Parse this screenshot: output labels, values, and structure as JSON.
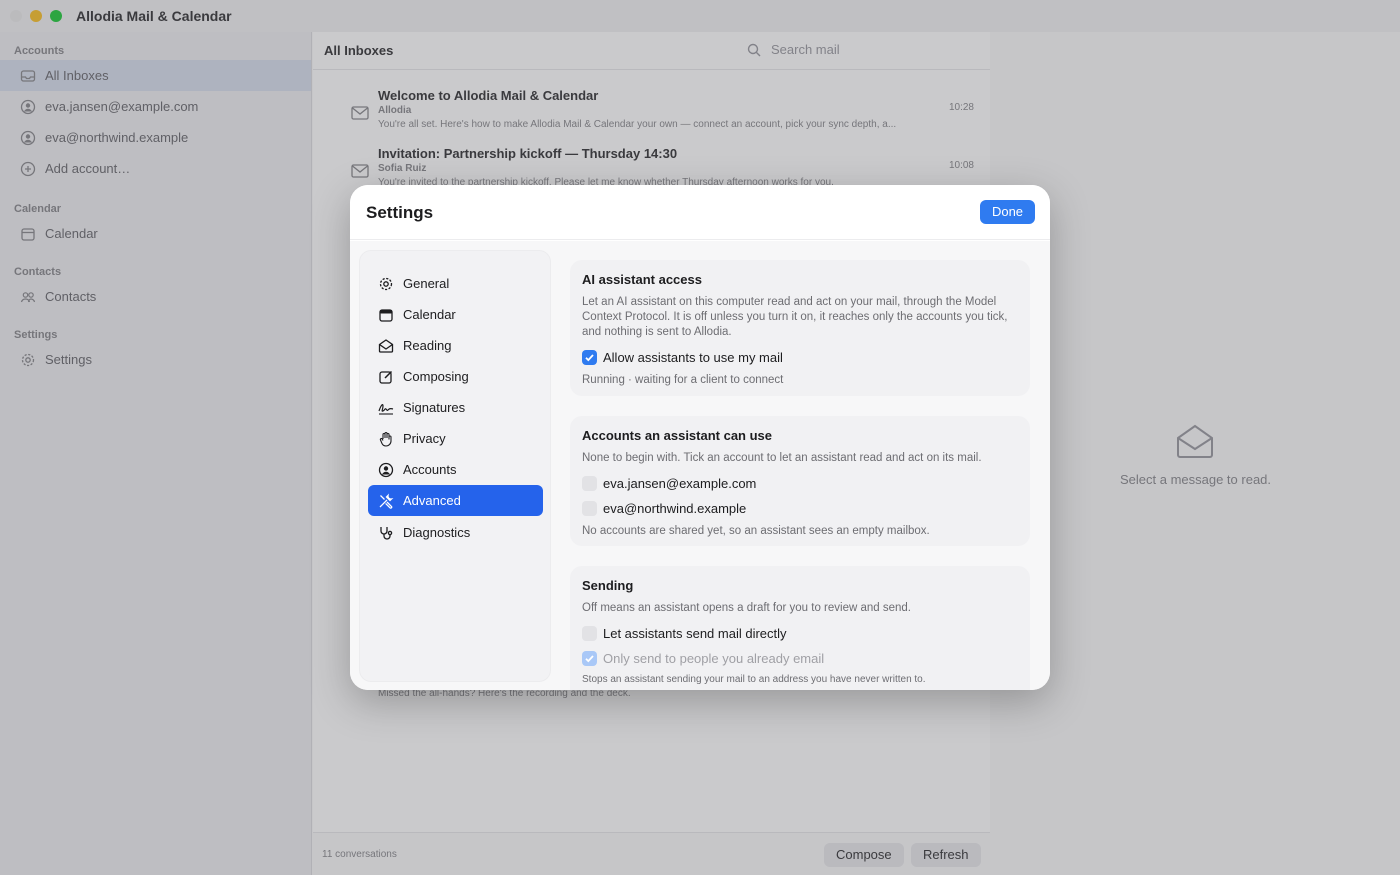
{
  "window": {
    "title": "Allodia Mail & Calendar"
  },
  "sidebar": {
    "sections": {
      "accounts": "Accounts",
      "calendar": "Calendar",
      "contacts": "Contacts",
      "settings": "Settings"
    },
    "items": [
      {
        "label": "All Inboxes",
        "icon": "inbox-icon",
        "active": true
      },
      {
        "label": "eva.jansen@example.com",
        "icon": "account-icon"
      },
      {
        "label": "eva@northwind.example",
        "icon": "account-icon"
      },
      {
        "label": "Add account…",
        "icon": "plus-circle-icon"
      },
      {
        "label": "Calendar",
        "icon": "calendar-icon"
      },
      {
        "label": "Contacts",
        "icon": "people-icon"
      },
      {
        "label": "Settings",
        "icon": "gear-icon"
      }
    ]
  },
  "list": {
    "title": "All Inboxes",
    "search_placeholder": "Search mail",
    "messages": [
      {
        "subject": "Welcome to Allodia Mail & Calendar",
        "from": "Allodia",
        "preview": "You're all set. Here's how to make Allodia Mail & Calendar your own — connect an account, pick your sync depth, a...",
        "time": "10:28"
      },
      {
        "subject": "Invitation: Partnership kickoff — Thursday 14:30",
        "from": "Sofia Ruiz",
        "preview": "You're invited to the partnership kickoff. Please let me know whether Thursday afternoon works for you.",
        "time": "10:08"
      }
    ],
    "behind_preview": "Missed the all-hands? Here's the recording and the deck.",
    "footer": {
      "count": "11 conversations",
      "compose": "Compose",
      "refresh": "Refresh"
    }
  },
  "reader": {
    "placeholder": "Select a message to read."
  },
  "settings": {
    "title": "Settings",
    "done": "Done",
    "nav": [
      {
        "label": "General",
        "icon": "gear-icon"
      },
      {
        "label": "Calendar",
        "icon": "calendar-icon"
      },
      {
        "label": "Reading",
        "icon": "envelope-open-icon"
      },
      {
        "label": "Composing",
        "icon": "compose-icon"
      },
      {
        "label": "Signatures",
        "icon": "signature-icon"
      },
      {
        "label": "Privacy",
        "icon": "hand-icon"
      },
      {
        "label": "Accounts",
        "icon": "person-circle-icon"
      },
      {
        "label": "Advanced",
        "icon": "tools-icon",
        "active": true
      },
      {
        "label": "Diagnostics",
        "icon": "stethoscope-icon"
      }
    ],
    "ai_access": {
      "title": "AI assistant access",
      "desc": "Let an AI assistant on this computer read and act on your mail, through the Model Context Protocol. It is off unless you turn it on, it reaches only the accounts you tick, and nothing is sent to Allodia.",
      "toggle_label": "Allow assistants to use my mail",
      "toggle_checked": true,
      "status": "Running · waiting for a client to connect"
    },
    "accounts": {
      "title": "Accounts an assistant can use",
      "desc": "None to begin with. Tick an account to let an assistant read and act on its mail.",
      "items": [
        {
          "label": "eva.jansen@example.com",
          "checked": false
        },
        {
          "label": "eva@northwind.example",
          "checked": false
        }
      ],
      "note": "No accounts are shared yet, so an assistant sees an empty mailbox."
    },
    "sending": {
      "title": "Sending",
      "desc": "Off means an assistant opens a draft for you to review and send.",
      "direct_label": "Let assistants send mail directly",
      "direct_checked": false,
      "known_label": "Only send to people you already email",
      "known_checked": true,
      "known_disabled": true,
      "note": "Stops an assistant sending your mail to an address you have never written to."
    }
  },
  "colors": {
    "accent": "#2f7bf0",
    "nav_active": "#2563eb"
  }
}
